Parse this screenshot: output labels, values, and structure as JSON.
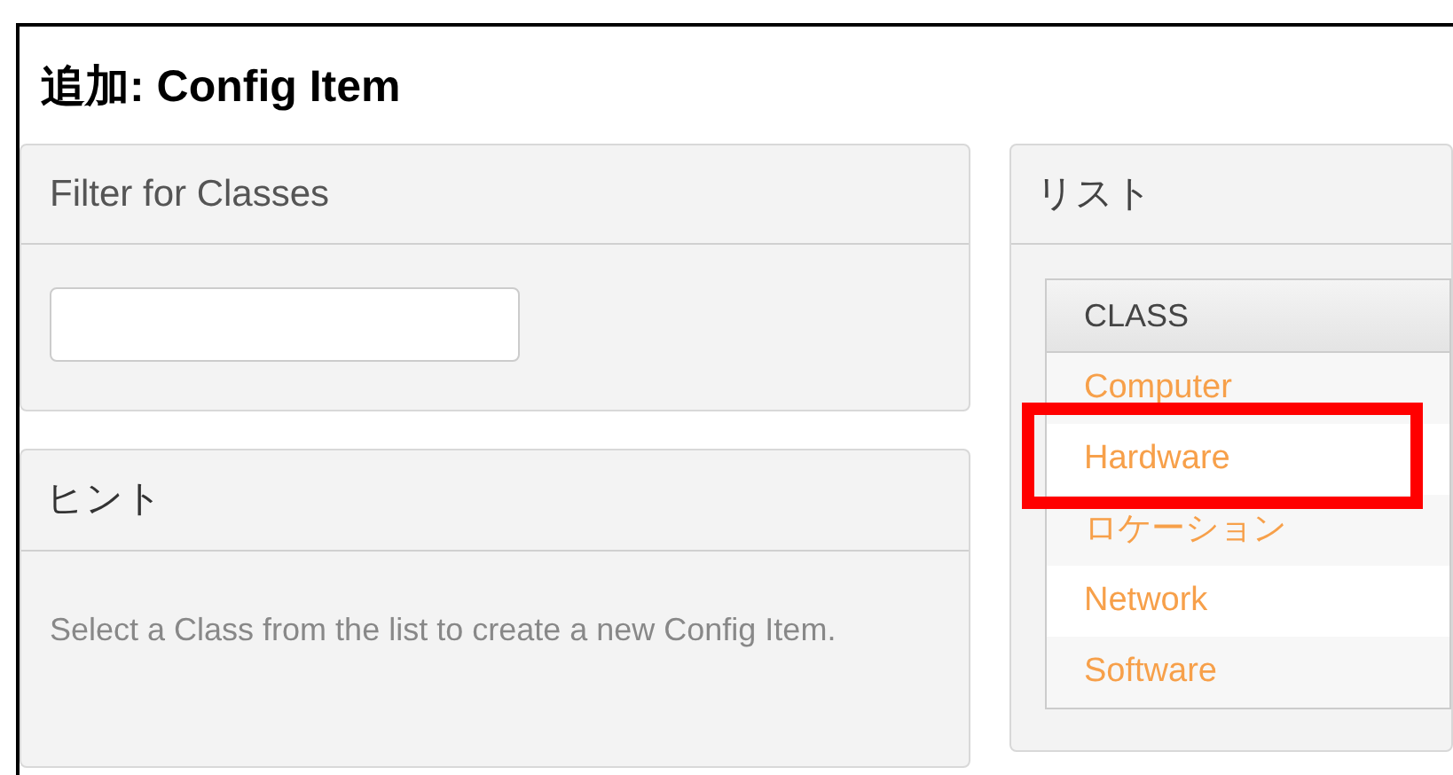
{
  "title": {
    "prefix": "追加:",
    "text": "Config Item"
  },
  "filter_panel": {
    "heading": "Filter for Classes"
  },
  "hint_panel": {
    "heading": "ヒント",
    "text": "Select a Class from the list to create a new Config Item."
  },
  "list_panel": {
    "heading": "リスト",
    "table": {
      "columns": [
        "CLASS"
      ],
      "rows": [
        {
          "label": "Computer",
          "highlighted": false
        },
        {
          "label": "Hardware",
          "highlighted": true
        },
        {
          "label": "ロケーション",
          "highlighted": false
        },
        {
          "label": "Network",
          "highlighted": false
        },
        {
          "label": "Software",
          "highlighted": false
        }
      ]
    }
  }
}
